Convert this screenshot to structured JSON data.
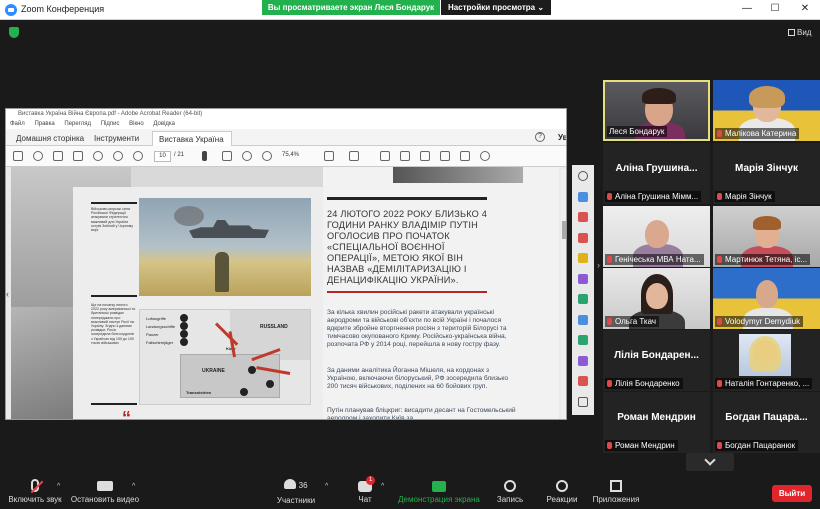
{
  "app": {
    "title": "Zoom Конференция",
    "share_banner": "Вы просматриваете экран Леся Бондарук",
    "view_options": "Настройки просмотра",
    "view_options_caret": "⌄",
    "view_button": "Вид",
    "window_controls": [
      "—",
      "☐",
      "✕"
    ]
  },
  "acrobat": {
    "window_title": "Виставка Україна Війна Європа.pdf - Adobe Acrobat Reader (64-bit)",
    "menu": [
      "Файл",
      "Правка",
      "Перегляд",
      "Підпис",
      "Вікно",
      "Довідка"
    ],
    "tabs": [
      {
        "label": "Домашня сторінка",
        "active": false
      },
      {
        "label": "Інструменти",
        "active": false
      },
      {
        "label": "Виставка Україна ...",
        "active": true
      }
    ],
    "tab_close": "✕",
    "help_icon": "?",
    "sign_in": "Увійти",
    "page_current": "10",
    "page_total": "/ 21",
    "zoom": "75,4%",
    "expand_left": "‹",
    "expand_right": "›"
  },
  "document": {
    "headline": "24 ЛЮТОГО 2022 РОКУ БЛИЗЬКО 4 ГОДИНИ РАНКУ ВЛАДІМІР ПУТІН ОГОЛОСИВ ПРО ПОЧАТОК «СПЕЦІАЛЬНОЇ ВОЄННОЇ ОПЕРАЦІЇ», МЕТОЮ ЯКОЇ ВІН НАЗВАВ «ДЕМІЛІТАРИЗАЦІЮ І ДЕНАЦИФІКАЦІЮ УКРАЇНИ».",
    "paragraphs": [
      "За кілька хвилин російські ракети атакували українські аеродроми та військові об'єкти по всій Україні і почалося вдкрите збройне вторгнення росіян з територій Білорусі та тимчасово окупованого Криму. Російсько-українська війна, розпочата РФ у 2014 році, перейшла в нову гостру фазу.",
      "За даними аналітика Йоганна Мішеля, на кордонах з Україною, включаючи білоруський, РФ зосередила близько 200 тисяч військових, поділених на 60 бойових груп.",
      "Путін планував бліцкриг: висадити десант на Гостомельський аеродром і захопити Київ за"
    ],
    "side_note_1": "Військово-морські сили Російської Федерації атакували стратегічно важливий для України острів Зміїний у Чорному морі",
    "side_note_2": "Ще на початку лютого 2022 року американські та британські розвідки попереджали про можливий наступ Росії на Україну. Згідно з даними розвідки, Росія зосередила біля кордонів з Україною від 150 до 190 тисяч військових",
    "quote_mark": "“",
    "map": {
      "country_ru": "RUSSLAND",
      "country_ua": "UKRAINE",
      "city_label": "Kiew",
      "legend": [
        "Luftangriffe",
        "Landungsschiffe",
        "Panzer",
        "Fallschirmjäger"
      ],
      "transnistrien": "Transnistrien"
    }
  },
  "participants": [
    {
      "name": "Леся Бондарук",
      "video": true,
      "active": true
    },
    {
      "name": "Малікова Катерина",
      "video": true,
      "active": false
    },
    {
      "name": "Аліна Грушина Мімм...",
      "big_name": "Аліна  Грушина...",
      "video": false
    },
    {
      "name": "Марія Зінчук",
      "big_name": "Марія Зінчук",
      "video": false
    },
    {
      "name": "Генічеська МВА Ната...",
      "video": true
    },
    {
      "name": "Мартинюк Тетяна, іс...",
      "video": true
    },
    {
      "name": "Ольга Ткач",
      "video": true
    },
    {
      "name": "Volodymyr Demydiuk",
      "video": true
    },
    {
      "name": "Лілія Бондаренко",
      "big_name": "Лілія  Бондарен...",
      "video": false
    },
    {
      "name": "Наталія Гонтаренко, ...",
      "video": true
    },
    {
      "name": "Роман Мендрин",
      "big_name": "Роман Мендрин",
      "video": false
    },
    {
      "name": "Богдан Пацаранюк",
      "big_name": "Богдан  Пацара...",
      "video": false
    }
  ],
  "toolbar": {
    "unmute": "Включить звук",
    "video": "Остановить видео",
    "participants": "Участники",
    "participants_count": "36",
    "chat": "Чат",
    "chat_badge": "1",
    "share": "Демонстрация экрана",
    "record": "Запись",
    "reactions": "Реакции",
    "apps": "Приложения",
    "leave": "Выйти",
    "caret": "^"
  },
  "colors": {
    "accent_green": "#23b14d",
    "active_speaker": "#e6e07a",
    "leave_red": "#e0262c",
    "mic_off": "#e0484a"
  }
}
